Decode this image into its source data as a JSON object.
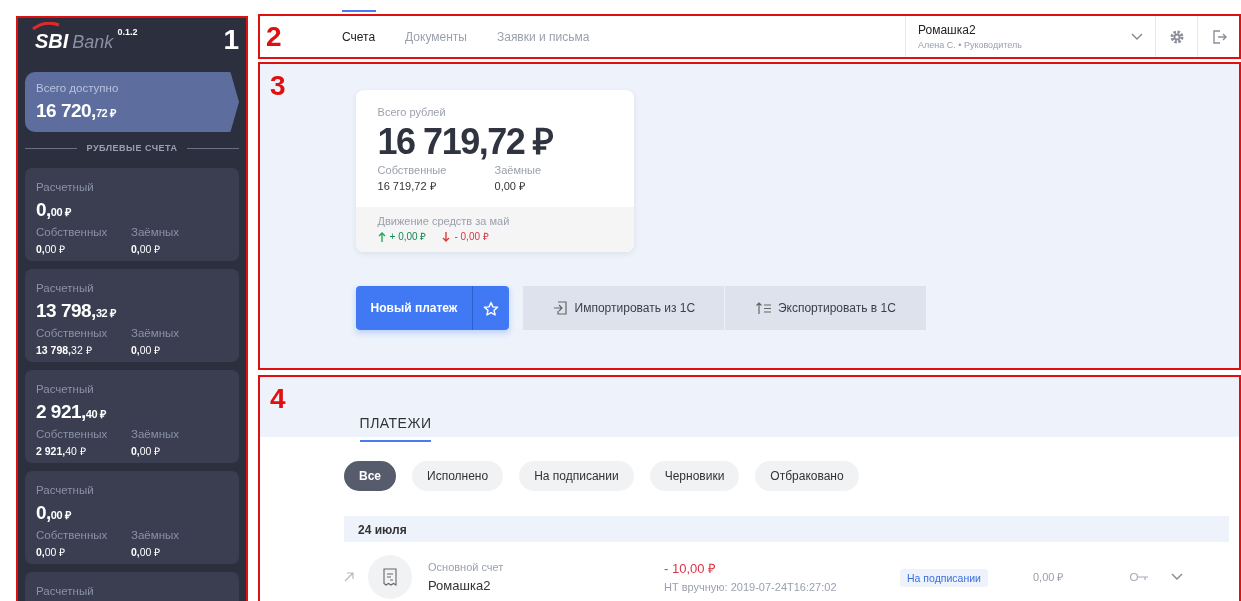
{
  "sidebar": {
    "annotation": "1",
    "logo": {
      "brand": "SBI",
      "word": "Bank",
      "version": "0.1.2"
    },
    "total": {
      "label": "Всего доступно",
      "main": "16 720,",
      "cents": "72 ₽",
      "selected": true
    },
    "section_title": "РУБЛЕВЫЕ СЧЕТА",
    "accounts": [
      {
        "name": "Расчетный",
        "main": "0,",
        "cents": "00 ₽",
        "own_label": "Собственных",
        "own": "**0,**00 ₽",
        "loan_label": "Заёмных",
        "loan": "**0,**00 ₽"
      },
      {
        "name": "Расчетный",
        "main": "13 798,",
        "cents": "32 ₽",
        "own_label": "Собственных",
        "own": "**13 798,**32 ₽",
        "loan_label": "Заёмных",
        "loan": "**0,**00 ₽"
      },
      {
        "name": "Расчетный",
        "main": "2 921,",
        "cents": "40 ₽",
        "own_label": "Собственных",
        "own": "**2 921,**40 ₽",
        "loan_label": "Заёмных",
        "loan": "**0,**00 ₽"
      },
      {
        "name": "Расчетный",
        "main": "0,",
        "cents": "00 ₽",
        "own_label": "Собственных",
        "own": "**0,**00 ₽",
        "loan_label": "Заёмных",
        "loan": "**0,**00 ₽"
      },
      {
        "name": "Расчетный"
      }
    ]
  },
  "topbar": {
    "annotation": "2",
    "tabs": [
      {
        "label": "Счета",
        "selected": true
      },
      {
        "label": "Документы",
        "selected": false
      },
      {
        "label": "Заявки и письма",
        "selected": false
      }
    ],
    "company": {
      "name": "Ромашка2",
      "user": "Алена С. • Руководитель"
    }
  },
  "summary": {
    "annotation": "3",
    "card": {
      "title": "Всего рублей",
      "amount": "16 719,72 ₽",
      "own_label": "Собственные",
      "own": "16 719,72 ₽",
      "loan_label": "Заёмные",
      "loan": "0,00 ₽",
      "movement_label": "Движение средств за май",
      "income": "+ 0,00 ₽",
      "outcome": "- 0,00 ₽"
    },
    "new_payment": "Новый платеж",
    "import": "Импортировать из 1С",
    "export": "Экспортировать в 1С"
  },
  "payments": {
    "annotation": "4",
    "title": "ПЛАТЕЖИ",
    "filters": [
      {
        "label": "Все",
        "selected": true
      },
      {
        "label": "Исполнено",
        "selected": false
      },
      {
        "label": "На подписании",
        "selected": false
      },
      {
        "label": "Черновики",
        "selected": false
      },
      {
        "label": "Отбраковано",
        "selected": false
      }
    ],
    "date": "24 июля",
    "rows": [
      {
        "account": "Основной счет",
        "counterparty": "Ромашка2",
        "amount": "- 10,00 ₽",
        "note": "НТ вручную: 2019-07-24T16:27:02",
        "status": "На подписании",
        "fee": "0,00 ₽"
      }
    ]
  }
}
